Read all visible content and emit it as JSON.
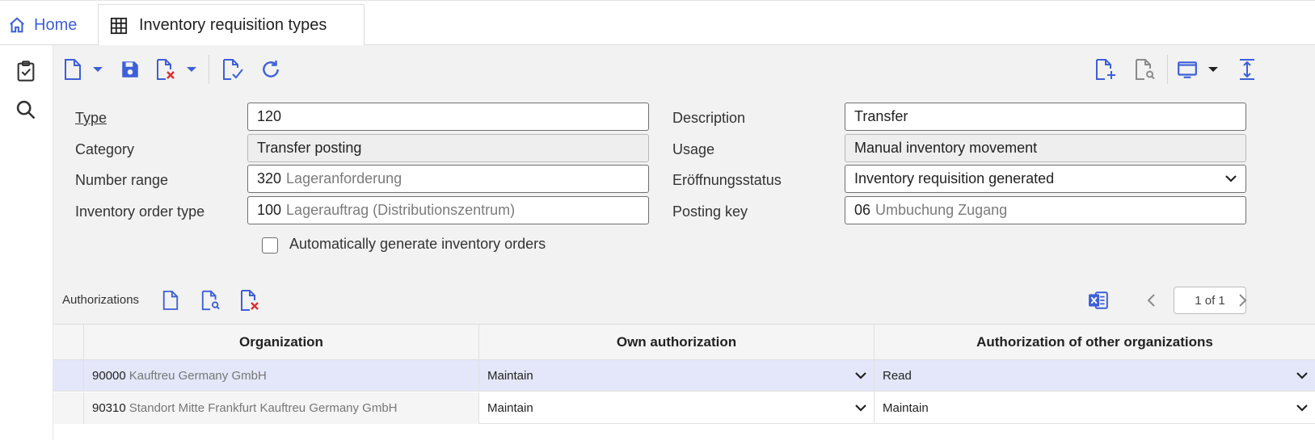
{
  "tabs": {
    "home": "Home",
    "active": "Inventory requisition types"
  },
  "form": {
    "type_label": "Type",
    "type_value": "120",
    "description_label": "Description",
    "description_value": "Transfer",
    "category_label": "Category",
    "category_value": "Transfer posting",
    "usage_label": "Usage",
    "usage_value": "Manual inventory movement",
    "number_range_label": "Number range",
    "number_range_code": "320",
    "number_range_name": "Lageranforderung",
    "opening_status_label": "Eröffnungsstatus",
    "opening_status_value": "Inventory requisition generated",
    "inventory_order_type_label": "Inventory order type",
    "inventory_order_type_code": "100",
    "inventory_order_type_name": "Lagerauftrag (Distributionszentrum)",
    "posting_key_label": "Posting key",
    "posting_key_code": "06",
    "posting_key_name": "Umbuchung Zugang",
    "auto_generate_label": "Automatically generate inventory orders",
    "auto_generate_checked": false
  },
  "authorizations": {
    "title": "Authorizations",
    "pager": "1 of 1",
    "columns": [
      "Organization",
      "Own authorization",
      "Authorization of other organizations"
    ],
    "rows": [
      {
        "org_code": "90000",
        "org_name": "Kauftreu Germany GmbH",
        "own": "Maintain",
        "other": "Read",
        "selected": true
      },
      {
        "org_code": "90310",
        "org_name": "Standort Mitte Frankfurt Kauftreu Germany GmbH",
        "own": "Maintain",
        "other": "Maintain",
        "selected": false
      }
    ]
  },
  "colors": {
    "accent": "#3d5fd8",
    "delete": "#d9322f",
    "selected_row": "#e4e6f9",
    "panel": "#f2f2f2"
  }
}
